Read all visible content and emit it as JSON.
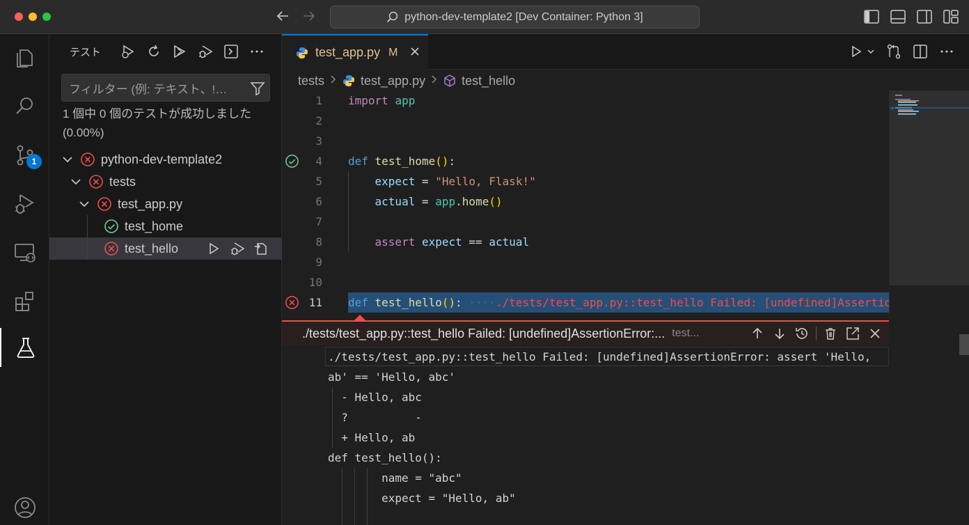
{
  "window": {
    "title": "python-dev-template2 [Dev Container: Python 3]"
  },
  "activity_bar": {
    "source_control_badge": "1"
  },
  "sidebar": {
    "title": "テスト",
    "filter_placeholder": "フィルター (例: テキスト、!…",
    "summary": "1 個中 0 個のテストが成功しました (0.00%)",
    "tree": [
      {
        "label": "python-dev-template2",
        "status": "failed"
      },
      {
        "label": "tests",
        "status": "failed"
      },
      {
        "label": "test_app.py",
        "status": "failed"
      },
      {
        "label": "test_home",
        "status": "passed"
      },
      {
        "label": "test_hello",
        "status": "failed"
      }
    ]
  },
  "editor": {
    "tab": {
      "name": "test_app.py",
      "modified_marker": "M"
    },
    "breadcrumb": [
      "tests",
      "test_app.py",
      "test_hello"
    ],
    "lines": [
      "1",
      "2",
      "3",
      "4",
      "5",
      "6",
      "7",
      "8",
      "9",
      "10",
      "11"
    ],
    "inline_error": "./tests/test_app.py::test_hello Failed: [undefined]AssertionEr",
    "peek": {
      "title": "./tests/test_app.py::test_hello Failed: [undefined]AssertionError:...",
      "subtitle": "test...",
      "message_lines": [
        "./tests/test_app.py::test_hello Failed: [undefined]AssertionError: assert 'Hello,",
        "ab' == 'Hello, abc'",
        "  - Hello, abc",
        "  ?          -",
        "  + Hello, ab",
        "def test_hello():",
        "        name = \"abc\"",
        "        expect = \"Hello, ab\""
      ]
    }
  },
  "colors": {
    "accent": "#0078d4",
    "error": "#f14c4c",
    "success": "#73c991",
    "modified": "#e2c08d"
  }
}
